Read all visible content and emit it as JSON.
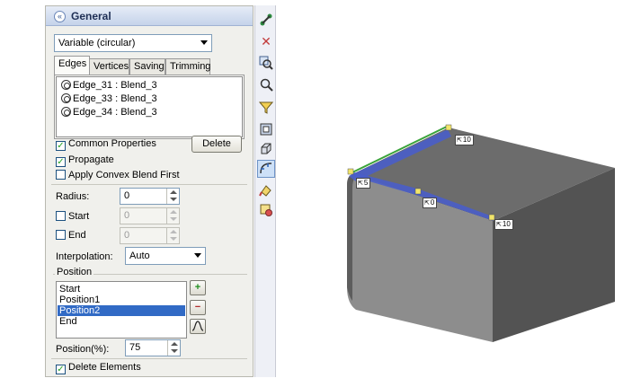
{
  "panel": {
    "title": "General",
    "collapse_glyph": "«",
    "blend_type": "Variable (circular)",
    "tabs": [
      "Edges",
      "Vertices",
      "Saving",
      "Trimming"
    ],
    "edges": [
      "Edge_31 : Blend_3",
      "Edge_33 : Blend_3",
      "Edge_34 : Blend_3"
    ],
    "common_properties": "Common Properties",
    "delete_button": "Delete",
    "propagate": "Propagate",
    "apply_convex": "Apply Convex Blend First",
    "radius_label": "Radius:",
    "radius_value": "0",
    "start_label": "Start",
    "start_value": "0",
    "end_label": "End",
    "end_value": "0",
    "interpolation_label": "Interpolation:",
    "interpolation_value": "Auto",
    "position_legend": "Position",
    "positions": [
      "Start",
      "Position1",
      "Position2",
      "End"
    ],
    "selected_position": "Position2",
    "add_glyph": "+",
    "remove_glyph": "−",
    "position_pct_label": "Position(%):",
    "position_pct_value": "75",
    "delete_elements": "Delete Elements"
  },
  "toolbar": {
    "icons": [
      "connect-icon",
      "close-x-icon",
      "zoom-select-icon",
      "zoom-region-icon",
      "filter-select-icon",
      "edge-blend-icon",
      "face-blend-icon",
      "variable-blend-icon",
      "paint-icon",
      "material-icon"
    ],
    "active_index": 7
  },
  "viewport": {
    "labels": [
      "10",
      "5",
      "0",
      "10"
    ],
    "colors": {
      "box_top": "#6c6c6c",
      "box_front": "#8d8d8d",
      "box_right": "#535353",
      "blend_highlight": "#4a5ec9",
      "green_edge": "#3aa33a",
      "handle": "#f2e56a"
    }
  }
}
